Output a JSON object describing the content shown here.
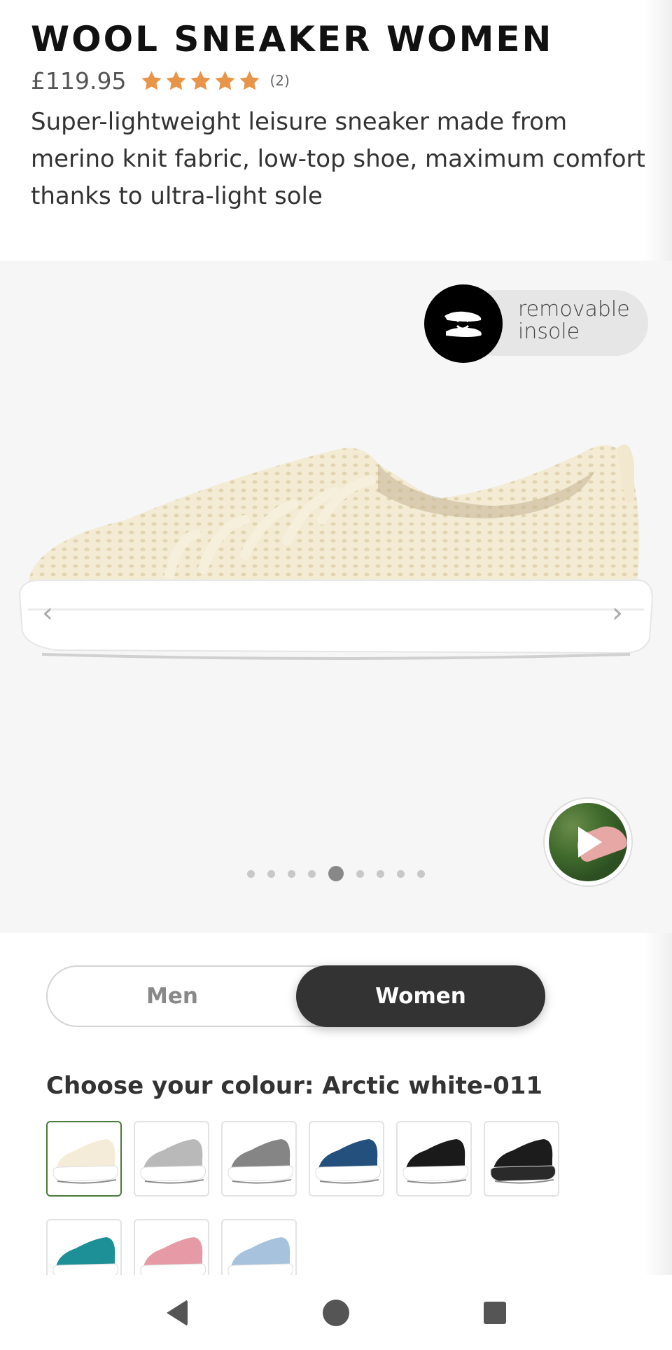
{
  "product": {
    "title": "WOOL SNEAKER WOMEN",
    "price": "£119.95",
    "rating": 5,
    "review_count": "(2)",
    "description": "Super-lightweight leisure sneaker made from merino knit fabric, low-top shoe, maximum comfort thanks to ultra-light sole"
  },
  "gallery": {
    "badge_line1": "removable",
    "badge_line2": "insole",
    "prev_arrow": "‹",
    "next_arrow": "›",
    "dots_total": 9,
    "active_dot_index": 4
  },
  "gender_toggle": {
    "men_label": "Men",
    "women_label": "Women",
    "selected": "Women"
  },
  "colour": {
    "heading": "Choose your colour: Arctic white-011",
    "swatches": [
      {
        "name": "arctic-white",
        "upper": "#f4ecd8",
        "sole": "#ffffff",
        "selected": true
      },
      {
        "name": "light-grey",
        "upper": "#b9b9b9",
        "sole": "#ffffff",
        "selected": false
      },
      {
        "name": "grey",
        "upper": "#858585",
        "sole": "#ffffff",
        "selected": false
      },
      {
        "name": "navy",
        "upper": "#24507e",
        "sole": "#ffffff",
        "selected": false
      },
      {
        "name": "black-white",
        "upper": "#1a1a1a",
        "sole": "#ffffff",
        "selected": false
      },
      {
        "name": "black",
        "upper": "#1c1c1c",
        "sole": "#2a2a2a",
        "selected": false
      },
      {
        "name": "teal",
        "upper": "#1c8f97",
        "sole": "#ffffff",
        "selected": false
      },
      {
        "name": "pink",
        "upper": "#e59aa5",
        "sole": "#ffffff",
        "selected": false
      },
      {
        "name": "light-blue",
        "upper": "#a7c2dc",
        "sole": "#ffffff",
        "selected": false
      }
    ]
  },
  "colors": {
    "star": "#e8954a",
    "selected_swatch_border": "#4b7a3c",
    "toggle_active": "#333333"
  },
  "nav": {
    "back": "back-icon",
    "home": "home-icon",
    "recents": "recents-icon"
  }
}
